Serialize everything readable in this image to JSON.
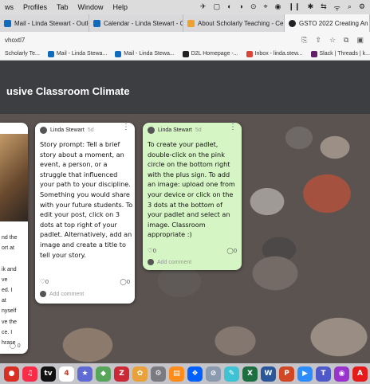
{
  "menubar": {
    "items": [
      "ws",
      "Profiles",
      "Tab",
      "Window",
      "Help"
    ],
    "status_icons": [
      "✈",
      "▢",
      "◐",
      "◑",
      "⊙",
      "⌖",
      "◉",
      "❙❙",
      "✱",
      "⇆",
      "ᯤ",
      "⌕",
      "⚙"
    ]
  },
  "tabs": [
    {
      "label": "Mail - Linda Stewart - Outlook",
      "icon_color": "#0f6cbd"
    },
    {
      "label": "Calendar - Linda Stewart - Ou",
      "icon_color": "#0f6cbd"
    },
    {
      "label": "About Scholarly Teaching - Ce",
      "icon_color": "#f0a030"
    },
    {
      "label": "GSTO 2022 Creating An I",
      "icon_color": "#222222"
    }
  ],
  "address": {
    "url": "vhoxtl7",
    "icons": [
      "⎘",
      "⇧",
      "☆",
      "⧉",
      "▣"
    ]
  },
  "bookmarks": [
    {
      "label": "Scholarly Te...",
      "icon_color": "#6b4c9a"
    },
    {
      "label": "Mail - Linda Stewa...",
      "icon_color": "#0f6cbd"
    },
    {
      "label": "Mail - Linda Stewa...",
      "icon_color": "#0f6cbd"
    },
    {
      "label": "D2L Homepage -...",
      "icon_color": "#222222"
    },
    {
      "label": "Inbox - linda.stew...",
      "icon_color": "#db4437"
    },
    {
      "label": "Slack | Threads | k...",
      "icon_color": "#611f69"
    }
  ],
  "page": {
    "title": "usive Classroom Climate"
  },
  "left_card": {
    "lines": "nd the\nort at\n\nik and\nve\ned. I\nat\nnyself\nve the\nce. I\nhrase",
    "comment_count": "0"
  },
  "card1": {
    "author": "Linda Stewart",
    "time": "5d",
    "body": "Story prompt: Tell a brief story about a moment, an event, a person, or a struggle that influenced your path to your discipline. Something you would share with your future students. To edit your post, click on 3 dots at top right of your padlet. Alternatively, add an image and create a title to tell your story.",
    "likes": "0",
    "comments": "0",
    "add_comment": "Add comment"
  },
  "card2": {
    "author": "Linda Stewart",
    "time": "5d",
    "body": "To create your padlet, double-click on the pink circle on the bottom right with the plus sign. To add an image: upload one from your device or click on the 3 dots at the bottom of your padlet and select an image. Classroom appropriate :)",
    "likes": "0",
    "comments": "0",
    "add_comment": "Add comment"
  },
  "dock": [
    {
      "name": "chrome",
      "color": "#d93025",
      "glyph": "●"
    },
    {
      "name": "music",
      "color": "#fa2d48",
      "glyph": "♫"
    },
    {
      "name": "tv",
      "color": "#111111",
      "glyph": "tv"
    },
    {
      "name": "calendar",
      "color": "#ffffff",
      "glyph": "4"
    },
    {
      "name": "star",
      "color": "#5f6ad4",
      "glyph": "★"
    },
    {
      "name": "maps",
      "color": "#58a55c",
      "glyph": "◆"
    },
    {
      "name": "zotero",
      "color": "#cc2936",
      "glyph": "Z"
    },
    {
      "name": "photos",
      "color": "#e9a23b",
      "glyph": "✿"
    },
    {
      "name": "settings",
      "color": "#7a7a80",
      "glyph": "⚙"
    },
    {
      "name": "books",
      "color": "#ff8c1a",
      "glyph": "▤"
    },
    {
      "name": "dropbox",
      "color": "#0061ff",
      "glyph": "❖"
    },
    {
      "name": "safari",
      "color": "#8a9bb0",
      "glyph": "⊘"
    },
    {
      "name": "pen",
      "color": "#3ec3d5",
      "glyph": "✎"
    },
    {
      "name": "excel",
      "color": "#1d6f42",
      "glyph": "X"
    },
    {
      "name": "word",
      "color": "#2b579a",
      "glyph": "W"
    },
    {
      "name": "powerpoint",
      "color": "#d24726",
      "glyph": "P"
    },
    {
      "name": "zoom",
      "color": "#2d8cff",
      "glyph": "▶"
    },
    {
      "name": "teams",
      "color": "#5059c9",
      "glyph": "T"
    },
    {
      "name": "podcasts",
      "color": "#9933cc",
      "glyph": "◉"
    },
    {
      "name": "acrobat",
      "color": "#e61a1a",
      "glyph": "A"
    }
  ]
}
